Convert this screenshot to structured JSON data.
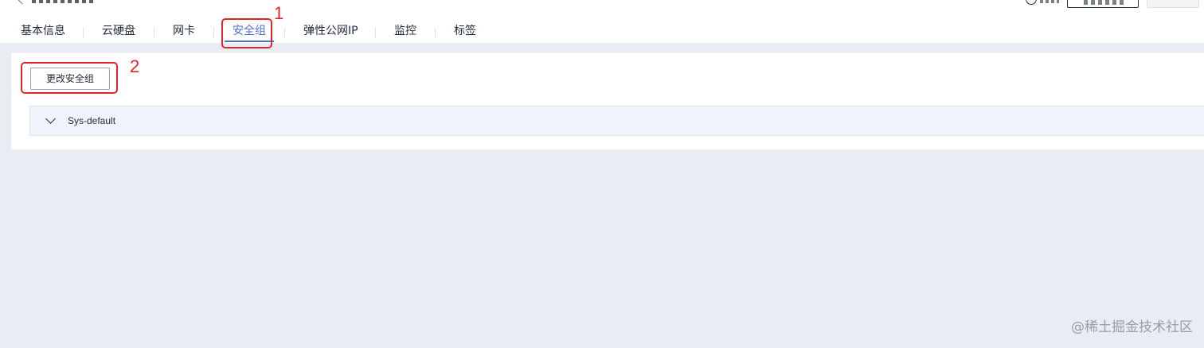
{
  "tabs": [
    {
      "label": "基本信息",
      "active": false
    },
    {
      "label": "云硬盘",
      "active": false
    },
    {
      "label": "网卡",
      "active": false
    },
    {
      "label": "安全组",
      "active": true
    },
    {
      "label": "弹性公网IP",
      "active": false
    },
    {
      "label": "监控",
      "active": false
    },
    {
      "label": "标签",
      "active": false
    }
  ],
  "security_group": {
    "change_button_label": "更改安全组",
    "groups": [
      {
        "name": "Sys-default",
        "expanded": false
      }
    ]
  },
  "annotations": [
    {
      "number": "1",
      "target": "安全组 tab"
    },
    {
      "number": "2",
      "target": "更改安全组 button"
    }
  ],
  "watermark": "@稀土掘金技术社区",
  "colors": {
    "accent": "#526ecc",
    "annotation": "#e3252b",
    "page_background": "#e9ecf2",
    "group_row_background": "#f0f3f9"
  }
}
